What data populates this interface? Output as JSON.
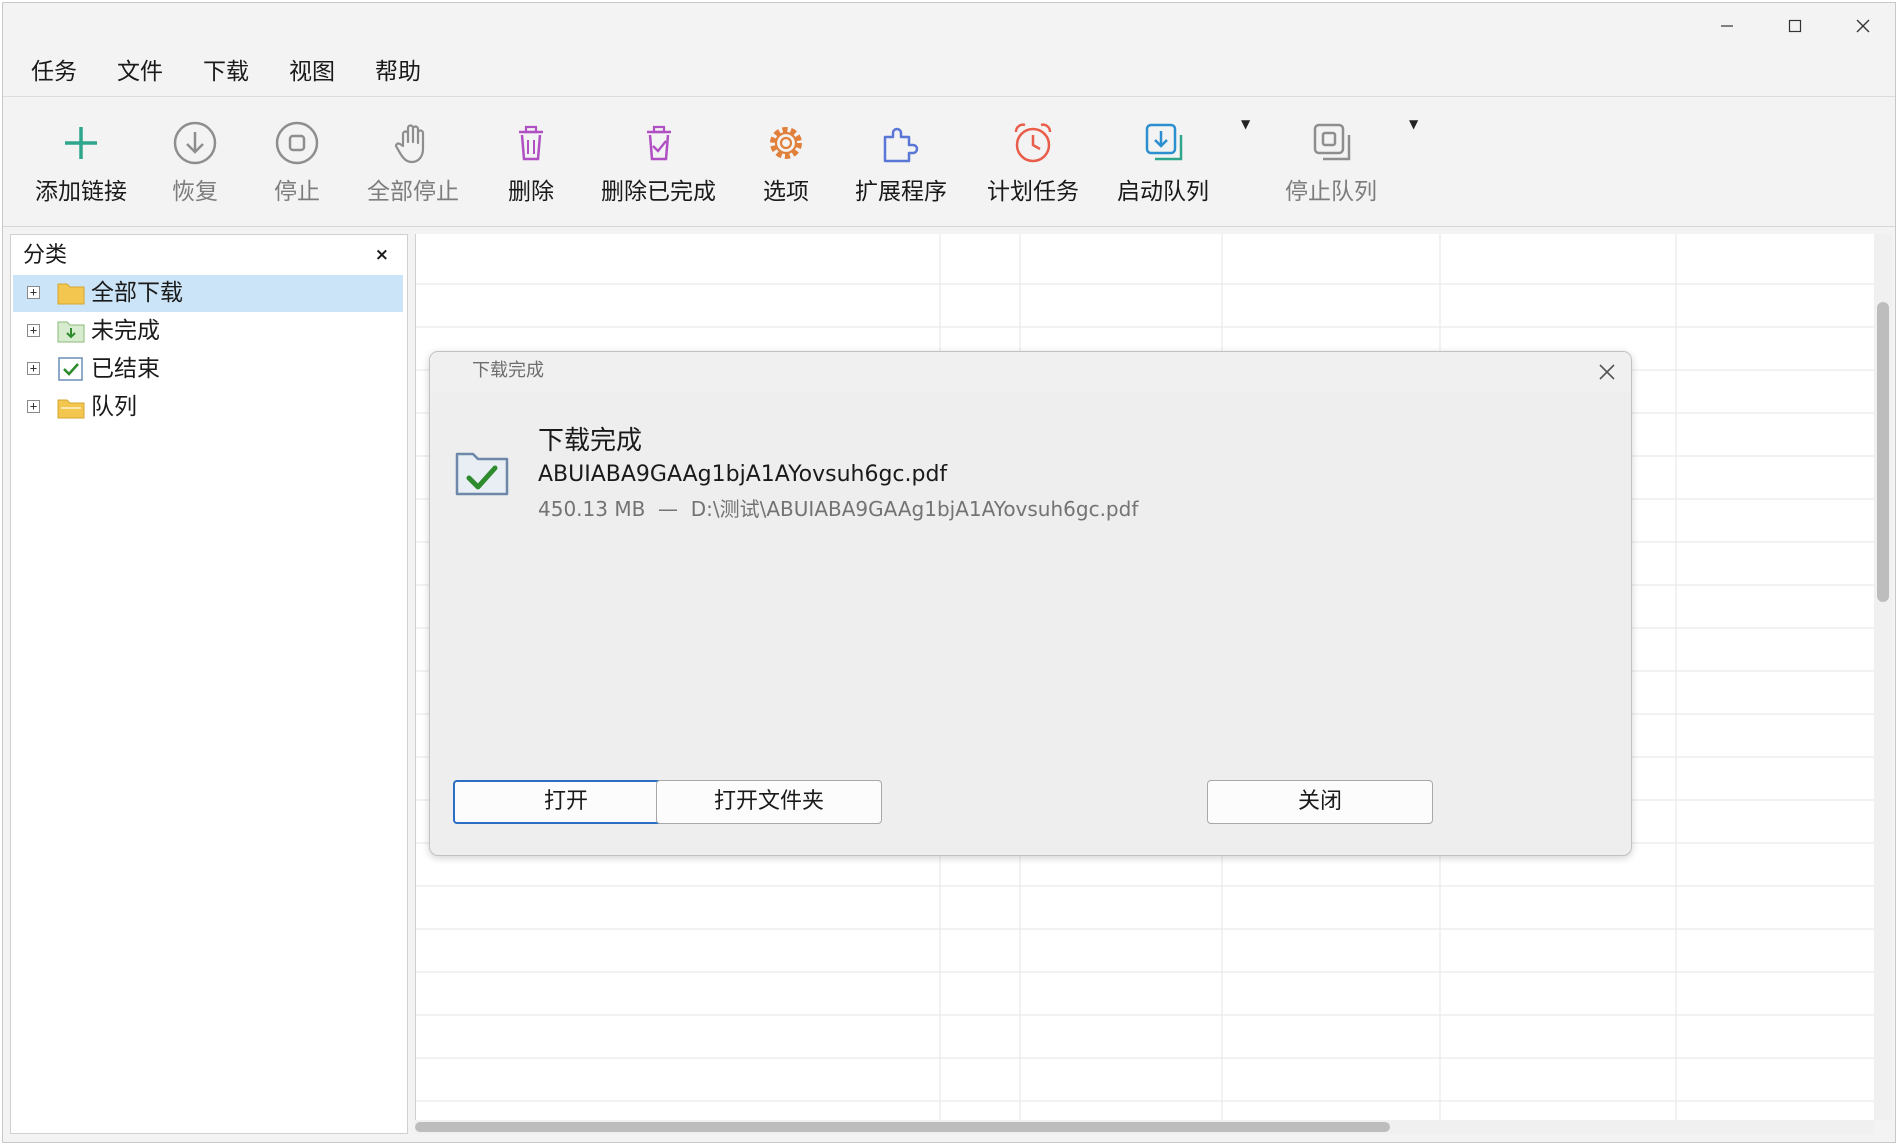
{
  "menubar": {
    "items": [
      "任务",
      "文件",
      "下载",
      "视图",
      "帮助"
    ]
  },
  "toolbar": {
    "buttons": [
      {
        "label": "添加链接",
        "icon": "add-link-icon",
        "enabled": true,
        "color": "#2fa58c"
      },
      {
        "label": "恢复",
        "icon": "resume-icon",
        "enabled": false,
        "color": "#8e8e8e"
      },
      {
        "label": "停止",
        "icon": "stop-icon",
        "enabled": false,
        "color": "#8e8e8e"
      },
      {
        "label": "全部停止",
        "icon": "stop-all-hand-icon",
        "enabled": false,
        "color": "#8e8e8e"
      },
      {
        "label": "删除",
        "icon": "trash-icon",
        "enabled": true,
        "color": "#b04fc4"
      },
      {
        "label": "删除已完成",
        "icon": "trash-check-icon",
        "enabled": true,
        "color": "#b04fc4"
      },
      {
        "label": "选项",
        "icon": "gear-icon",
        "enabled": true,
        "color": "#e0803a"
      },
      {
        "label": "扩展程序",
        "icon": "puzzle-icon",
        "enabled": true,
        "color": "#5a76d6"
      },
      {
        "label": "计划任务",
        "icon": "alarm-clock-icon",
        "enabled": true,
        "color": "#e85e4a"
      },
      {
        "label": "启动队列",
        "icon": "start-queue-icon",
        "enabled": true,
        "color": "#2b8fd0"
      },
      {
        "label": "停止队列",
        "icon": "stop-queue-icon",
        "enabled": false,
        "color": "#8e8e8e"
      }
    ],
    "dropdown_glyph": "▼"
  },
  "sidebar": {
    "header": "分类",
    "close_glyph": "×",
    "items": [
      {
        "label": "全部下载",
        "icon": "folder-icon",
        "selected": true
      },
      {
        "label": "未完成",
        "icon": "folder-download-icon",
        "selected": false
      },
      {
        "label": "已结束",
        "icon": "finished-check-icon",
        "selected": false
      },
      {
        "label": "队列",
        "icon": "queue-folder-icon",
        "selected": false
      }
    ]
  },
  "dialog": {
    "title": "下载完成",
    "heading": "下载完成",
    "filename": "ABUIABA9GAAg1bjA1AYovsuh6gc.pdf",
    "size": "450.13 MB",
    "separator": "—",
    "path": "D:\\测试\\ABUIABA9GAAg1bjA1AYovsuh6gc.pdf",
    "buttons": {
      "open": "打开",
      "open_folder": "打开文件夹",
      "close": "关闭"
    }
  },
  "colors": {
    "selection": "#cce4f7",
    "primary_button_border": "#2a6fc4",
    "check_green": "#2e8b2e"
  }
}
